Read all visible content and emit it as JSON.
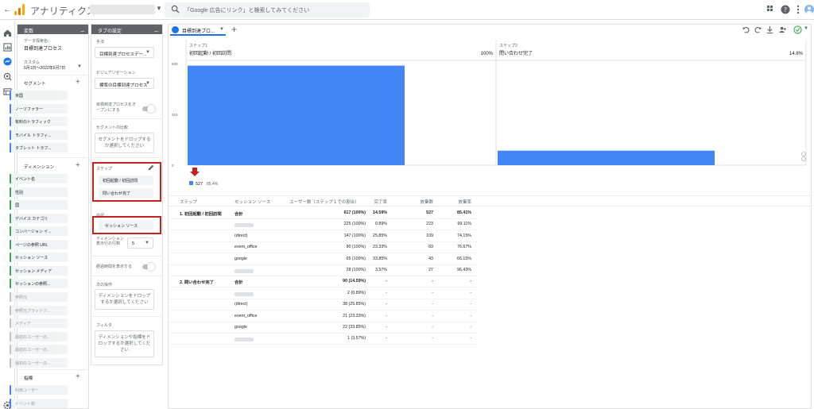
{
  "topbar": {
    "back": "←",
    "app_name": "アナリティクス",
    "search_placeholder": "「Google 広告にリンク」と検索してみてください",
    "logo_colors": [
      "#f9ab00",
      "#e37400",
      "#f9ab00"
    ]
  },
  "variables": {
    "header": "変数",
    "exploration_label": "データ探索名:",
    "exploration_name": "目標到達プロセス",
    "custom_label": "カスタム",
    "date_range": "6月1日〜2022年6月7日",
    "segments_title": "セグメント",
    "segments": [
      "米国",
      "ノーリファラー",
      "有料のトラフィック",
      "モバイル トラフィ...",
      "タブレット トラフ..."
    ],
    "dimensions_title": "ディメンション",
    "dimensions": [
      "イベント名",
      "性別",
      "国",
      "デバイス カテゴリ",
      "コンバージョン イ...",
      "ページの参照 URL",
      "セッション ソース",
      "セッション メディア",
      "セッションの参照..."
    ],
    "dimensions_greyed": [
      "参照元",
      "参照元プラットフ...",
      "メディア",
      "最初のユーザーの...",
      "最初のユーザーの...",
      "最初のユーザーの..."
    ],
    "metrics_title": "指標",
    "metrics": [
      "利用ユーザー",
      "イベント数"
    ]
  },
  "tab_settings": {
    "header": "タブの設定",
    "technique_label": "手法",
    "technique_value": "目標到達プロセスデー...",
    "viz_label": "ビジュアリゼーション",
    "viz_value": "標準の目標到達プロセス",
    "open_funnel_label": "目標到達プロセスをオープンにする",
    "segment_compare_label": "セグメントの比較",
    "segment_drop": "セグメントをドロップするか選択してください",
    "steps_label": "ステップ",
    "steps": [
      "初回起動 / 初回訪問",
      "問い合わせ完了"
    ],
    "breakdown_label": "内訳",
    "breakdown_value": "セッション ソース",
    "rows_label": "ディメンション表示行の行数",
    "rows_value": "5",
    "elapsed_label": "経過時間を表示する",
    "next_action_label": "次の操作",
    "next_action_drop": "ディメンションをドロップするか選択してください",
    "filter_label": "フィルタ",
    "filter_drop": "ディメンションや指標をドロップするか選択してください"
  },
  "main": {
    "tab_label": "目標到達プロ...",
    "tab_add": "+",
    "chart_data": {
      "type": "bar",
      "categories": [
        "初回起動 / 初回訪問",
        "問い合わせ完了"
      ],
      "step_labels": [
        "ステップ1",
        "ステップ2"
      ],
      "values": [
        617,
        90
      ],
      "percents": [
        "100%",
        "14.6%"
      ],
      "ylim": [
        0,
        630
      ],
      "yticks": [
        "630",
        "315",
        "0"
      ],
      "abandon_count": "527",
      "abandon_rate": "85.4%",
      "bar_color": "#4285f4",
      "arrow_color": "#c5221f"
    },
    "table": {
      "headers": [
        "ステップ",
        "セッション ソース",
        "ユーザー数（ステップ１での割合）",
        "完了率",
        "放棄数",
        "放棄率"
      ],
      "rows": [
        {
          "step": "1. 初回起動 / 初回訪問",
          "source": "合計",
          "users": "617 (100%)",
          "completion": "14.59%",
          "abandons": "527",
          "rate": "85.41%",
          "bold": true
        },
        {
          "step": "",
          "source": "",
          "users": "225 (100%)",
          "completion": "0.89%",
          "abandons": "223",
          "rate": "99.11%",
          "blurred": true
        },
        {
          "step": "",
          "source": "(direct)",
          "users": "147 (100%)",
          "completion": "25.85%",
          "abandons": "109",
          "rate": "74.15%"
        },
        {
          "step": "",
          "source": "event_office",
          "users": "90 (100%)",
          "completion": "23.33%",
          "abandons": "69",
          "rate": "76.67%"
        },
        {
          "step": "",
          "source": "google",
          "users": "65 (100%)",
          "completion": "33.85%",
          "abandons": "43",
          "rate": "66.15%"
        },
        {
          "step": "",
          "source": "",
          "users": "28 (100%)",
          "completion": "3.57%",
          "abandons": "27",
          "rate": "96.43%",
          "blurred": true
        },
        {
          "step": "2. 問い合わせ完了",
          "source": "合計",
          "users": "90 (14.59%)",
          "completion": "-",
          "abandons": "-",
          "rate": "-",
          "bold": true
        },
        {
          "step": "",
          "source": "",
          "users": "2 (0.89%)",
          "completion": "-",
          "abandons": "-",
          "rate": "-",
          "blurred": true
        },
        {
          "step": "",
          "source": "(direct)",
          "users": "38 (25.85%)",
          "completion": "-",
          "abandons": "-",
          "rate": "-"
        },
        {
          "step": "",
          "source": "event_office",
          "users": "21 (23.33%)",
          "completion": "-",
          "abandons": "-",
          "rate": "-"
        },
        {
          "step": "",
          "source": "google",
          "users": "22 (33.85%)",
          "completion": "-",
          "abandons": "-",
          "rate": "-"
        },
        {
          "step": "",
          "source": "",
          "users": "1 (3.57%)",
          "completion": "-",
          "abandons": "-",
          "rate": "-",
          "blurred": true
        }
      ]
    }
  }
}
